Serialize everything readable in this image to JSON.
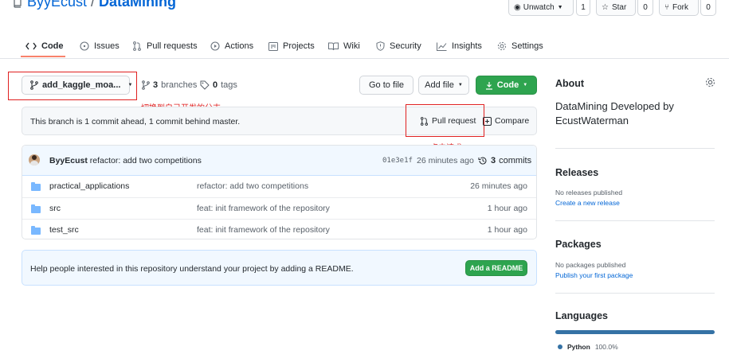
{
  "repo": {
    "owner": "ByyEcust",
    "separator": " / ",
    "name": "DataMining"
  },
  "header_actions": {
    "watch_label": "Unwatch",
    "watch_count": "1",
    "star_label": "Star",
    "star_count": "0",
    "fork_label": "Fork",
    "fork_count": "0"
  },
  "nav": {
    "tabs": [
      {
        "label": "Code",
        "icon": "code-icon",
        "active": true
      },
      {
        "label": "Issues",
        "icon": "issue-icon"
      },
      {
        "label": "Pull requests",
        "icon": "pull-request-icon"
      },
      {
        "label": "Actions",
        "icon": "play-icon"
      },
      {
        "label": "Projects",
        "icon": "project-icon"
      },
      {
        "label": "Wiki",
        "icon": "book-icon"
      },
      {
        "label": "Security",
        "icon": "shield-icon"
      },
      {
        "label": "Insights",
        "icon": "graph-icon"
      },
      {
        "label": "Settings",
        "icon": "gear-icon"
      }
    ],
    "accent": "#f9826c"
  },
  "branch_bar": {
    "branch_name": "add_kaggle_moa...",
    "branches_count": "3",
    "branches_label": "branches",
    "tags_count": "0",
    "tags_label": "tags",
    "go_to_file": "Go to file",
    "add_file": "Add file",
    "code_button": "Code"
  },
  "annotations": {
    "switch_branch": "切换到自己开发的分支",
    "click_request": "点击请求",
    "color": "#e02020"
  },
  "branch_status": {
    "message": "This branch is 1 commit ahead, 1 commit behind master.",
    "pull_request": "Pull request",
    "compare": "Compare"
  },
  "latest_commit": {
    "author": "ByyEcust",
    "message": "refactor: add two competitions",
    "sha": "01e3e1f",
    "age": "26 minutes ago",
    "commits_count": "3",
    "commits_label": "commits"
  },
  "files": [
    {
      "name": "practical_applications",
      "message": "refactor: add two competitions",
      "age": "26 minutes ago"
    },
    {
      "name": "src",
      "message": "feat: init framework of the repository",
      "age": "1 hour ago"
    },
    {
      "name": "test_src",
      "message": "feat: init framework of the repository",
      "age": "1 hour ago"
    }
  ],
  "readme_prompt": {
    "text": "Help people interested in this repository understand your project by adding a README.",
    "button": "Add a README"
  },
  "sidebar": {
    "about_heading": "About",
    "about_text": "DataMining Developed by EcustWaterman",
    "releases_heading": "Releases",
    "releases_text": "No releases published",
    "releases_link": "Create a new release",
    "packages_heading": "Packages",
    "packages_text": "No packages published",
    "packages_link": "Publish your first package",
    "languages_heading": "Languages",
    "language_name": "Python",
    "language_percent": "100.0%",
    "language_share": 1.0,
    "language_color": "#3572A5"
  }
}
